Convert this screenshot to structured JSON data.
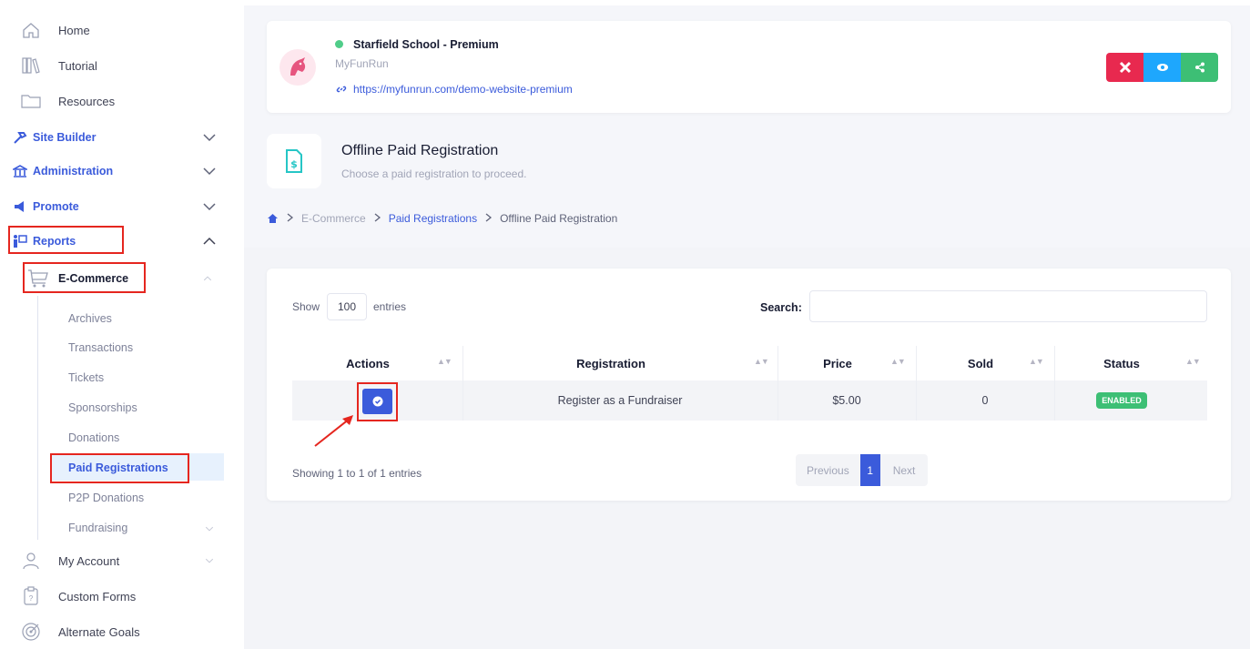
{
  "sidebar": {
    "top_items": [
      {
        "label": "Home",
        "icon": "home-icon"
      },
      {
        "label": "Tutorial",
        "icon": "books-icon"
      },
      {
        "label": "Resources",
        "icon": "folder-icon"
      }
    ],
    "sections": [
      {
        "label": "Site Builder",
        "icon": "hammer-icon"
      },
      {
        "label": "Administration",
        "icon": "bank-icon"
      },
      {
        "label": "Promote",
        "icon": "megaphone-icon"
      },
      {
        "label": "Reports",
        "icon": "reports-icon"
      }
    ],
    "ecommerce_label": "E-Commerce",
    "ecommerce_subitems": [
      "Archives",
      "Transactions",
      "Tickets",
      "Sponsorships",
      "Donations",
      "Paid Registrations",
      "P2P Donations",
      "Fundraising"
    ],
    "bottom_items": [
      {
        "label": "My Account",
        "icon": "user-icon"
      },
      {
        "label": "Custom Forms",
        "icon": "form-icon"
      },
      {
        "label": "Alternate Goals",
        "icon": "goal-icon"
      }
    ]
  },
  "site": {
    "name": "Starfield School - Premium",
    "subtitle": "MyFunRun",
    "url": "https://myfunrun.com/demo-website-premium",
    "status_color": "#50cd89"
  },
  "page": {
    "title": "Offline Paid Registration",
    "subtitle": "Choose a paid registration to proceed.",
    "breadcrumb": [
      "E-Commerce",
      "Paid Registrations",
      "Offline Paid Registration"
    ]
  },
  "table": {
    "show_label": "Show",
    "entries_value": "100",
    "entries_label": "entries",
    "search_label": "Search:",
    "columns": [
      "Actions",
      "Registration",
      "Price",
      "Sold",
      "Status"
    ],
    "rows": [
      {
        "registration": "Register as a Fundraiser",
        "price": "$5.00",
        "sold": "0",
        "status": "ENABLED"
      }
    ],
    "info": "Showing 1 to 1 of 1 entries",
    "pagination": {
      "previous": "Previous",
      "current": "1",
      "next": "Next"
    }
  },
  "colors": {
    "primary": "#3b5bdb",
    "danger": "#e8294f",
    "info": "#1ea7fd",
    "success": "#3dbf75",
    "highlight": "#e5261f"
  }
}
